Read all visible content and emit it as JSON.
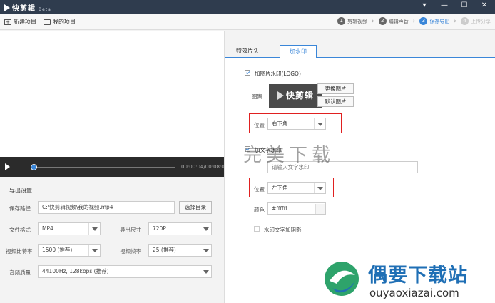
{
  "app": {
    "name": "快剪辑",
    "badge": "Beta"
  },
  "window_controls": [
    "▾",
    "—",
    "☐",
    "✕"
  ],
  "toolbar": {
    "new_project": "新建项目",
    "my_projects": "我的项目"
  },
  "steps": [
    {
      "num": "1",
      "label": "剪辑视频",
      "state": "done"
    },
    {
      "num": "2",
      "label": "编辑声音",
      "state": "done"
    },
    {
      "num": "3",
      "label": "保存导出",
      "state": "active"
    },
    {
      "num": "4",
      "label": "上传分享",
      "state": "disabled"
    }
  ],
  "player": {
    "time": "00:00:04/00:08:04",
    "progress": 0.0
  },
  "export_settings": {
    "title": "导出设置",
    "save_path_label": "保存路径",
    "save_path_value": "C:\\快剪辑视频\\我的视频.mp4",
    "choose_dir_button": "选择目录",
    "format_label": "文件格式",
    "format_value": "MP4",
    "size_label": "导出尺寸",
    "size_value": "720P",
    "bitrate_label": "视频比特率",
    "bitrate_value": "1500 (推荐)",
    "framerate_label": "视频帧率",
    "framerate_value": "25 (推荐)",
    "audio_label": "音频质量",
    "audio_value": "44100Hz, 128kbps (推荐)"
  },
  "tabs": [
    {
      "label": "特效片头",
      "active": false
    },
    {
      "label": "加水印",
      "active": true
    }
  ],
  "watermark_panel": {
    "image_wm_label": "加图片水印(LOGO)",
    "image_wm_checked": true,
    "pattern_label": "图案",
    "logo_text": "快剪辑",
    "change_image_button": "更换图片",
    "default_image_button": "默认图片",
    "position_label": "位置",
    "image_position_value": "右下角",
    "text_wm_label": "加文字水印",
    "text_wm_checked": true,
    "text_input_placeholder": "请输入文字水印",
    "text_position_value": "左下角",
    "color_label": "颜色",
    "color_value": "#ffffff",
    "shadow_label": "水印文字加阴影",
    "shadow_checked": false
  },
  "overlay_watermark": "完美下载",
  "brand": {
    "name": "偶要下载站",
    "url": "ouyaoxiazai.com"
  },
  "colors": {
    "accent": "#3a86d8",
    "titlebar": "#2f3c4e",
    "highlight": "#e02020",
    "brand": "#1f6fb5"
  }
}
